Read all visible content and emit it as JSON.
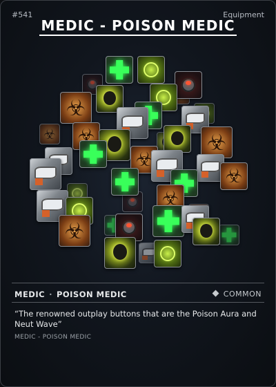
{
  "card": {
    "id": "#541",
    "type": "Equipment",
    "title": "MEDIC - POISON MEDIC",
    "category": "MEDIC",
    "subcategory": "POISON MEDIC",
    "rarity": "COMMON",
    "rarity_icon": "diamond-icon",
    "quote": "“The renowned outplay buttons that are the Poison Aura and Neut Wave”",
    "tag": "MEDIC - POISON MEDIC"
  },
  "colors": {
    "background": "#0d0f12",
    "accent_green": "#39ff5a",
    "biohazard_orange": "#e7a14b",
    "toxic_yellow": "#e8f05a"
  },
  "artwork": {
    "icon_types": [
      "plus-icon",
      "biohazard-icon",
      "toxic-orb-icon",
      "mech-arm-icon",
      "grenade-icon",
      "bomb-icon"
    ]
  }
}
